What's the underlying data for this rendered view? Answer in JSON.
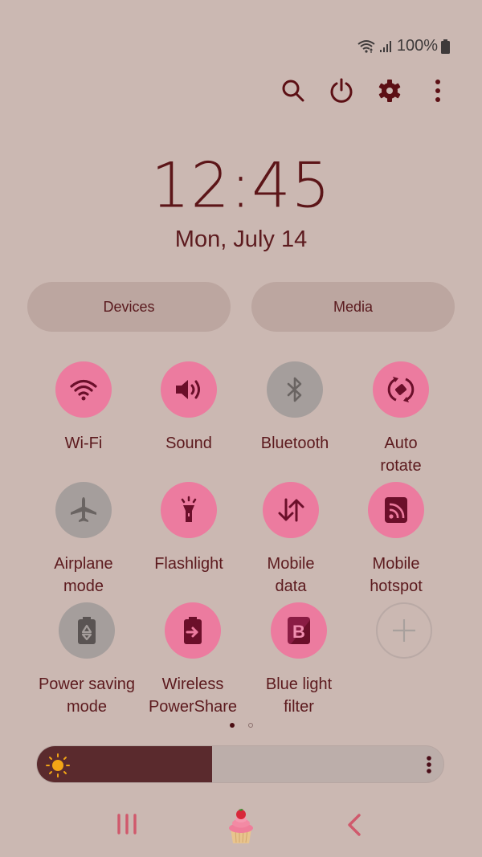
{
  "status_bar": {
    "battery_text": "100%",
    "icons": [
      "wifi-icon",
      "signal-icon",
      "battery-icon"
    ]
  },
  "top_actions": [
    {
      "name": "search",
      "icon": "search-icon"
    },
    {
      "name": "power",
      "icon": "power-icon"
    },
    {
      "name": "settings",
      "icon": "gear-icon"
    },
    {
      "name": "more",
      "icon": "more-vertical-icon"
    }
  ],
  "clock": {
    "time": "12:45",
    "date": "Mon, July 14"
  },
  "pills": {
    "devices": "Devices",
    "media": "Media"
  },
  "tiles": [
    {
      "label": "Wi-Fi",
      "icon": "wifi-icon",
      "state": "on"
    },
    {
      "label": "Sound",
      "icon": "sound-icon",
      "state": "on"
    },
    {
      "label": "Bluetooth",
      "icon": "bluetooth-icon",
      "state": "off"
    },
    {
      "label": "Auto\nrotate",
      "icon": "auto-rotate-icon",
      "state": "on"
    },
    {
      "label": "Airplane\nmode",
      "icon": "airplane-icon",
      "state": "off"
    },
    {
      "label": "Flashlight",
      "icon": "flashlight-icon",
      "state": "on"
    },
    {
      "label": "Mobile\ndata",
      "icon": "mobile-data-icon",
      "state": "on"
    },
    {
      "label": "Mobile\nhotspot",
      "icon": "hotspot-icon",
      "state": "on"
    },
    {
      "label": "Power saving\nmode",
      "icon": "power-saving-icon",
      "state": "off"
    },
    {
      "label": "Wireless\nPowerShare",
      "icon": "powershare-icon",
      "state": "on"
    },
    {
      "label": "Blue light\nfilter",
      "icon": "blue-light-icon",
      "state": "on"
    }
  ],
  "add_tile": {
    "icon": "plus-icon"
  },
  "pagination": {
    "current": 1,
    "total": 2
  },
  "brightness": {
    "level_percent": 43
  },
  "colors": {
    "background": "#cbb8b2",
    "tile_on": "#ec7b9f",
    "tile_off": "#a59e9c",
    "text": "#5c1a1e",
    "brightness_fill": "#5a2a2d",
    "sun": "#f2a516"
  },
  "navbar": [
    {
      "name": "recents",
      "icon": "recents-icon"
    },
    {
      "name": "home",
      "icon": "cupcake-home-icon"
    },
    {
      "name": "back",
      "icon": "back-icon"
    }
  ]
}
